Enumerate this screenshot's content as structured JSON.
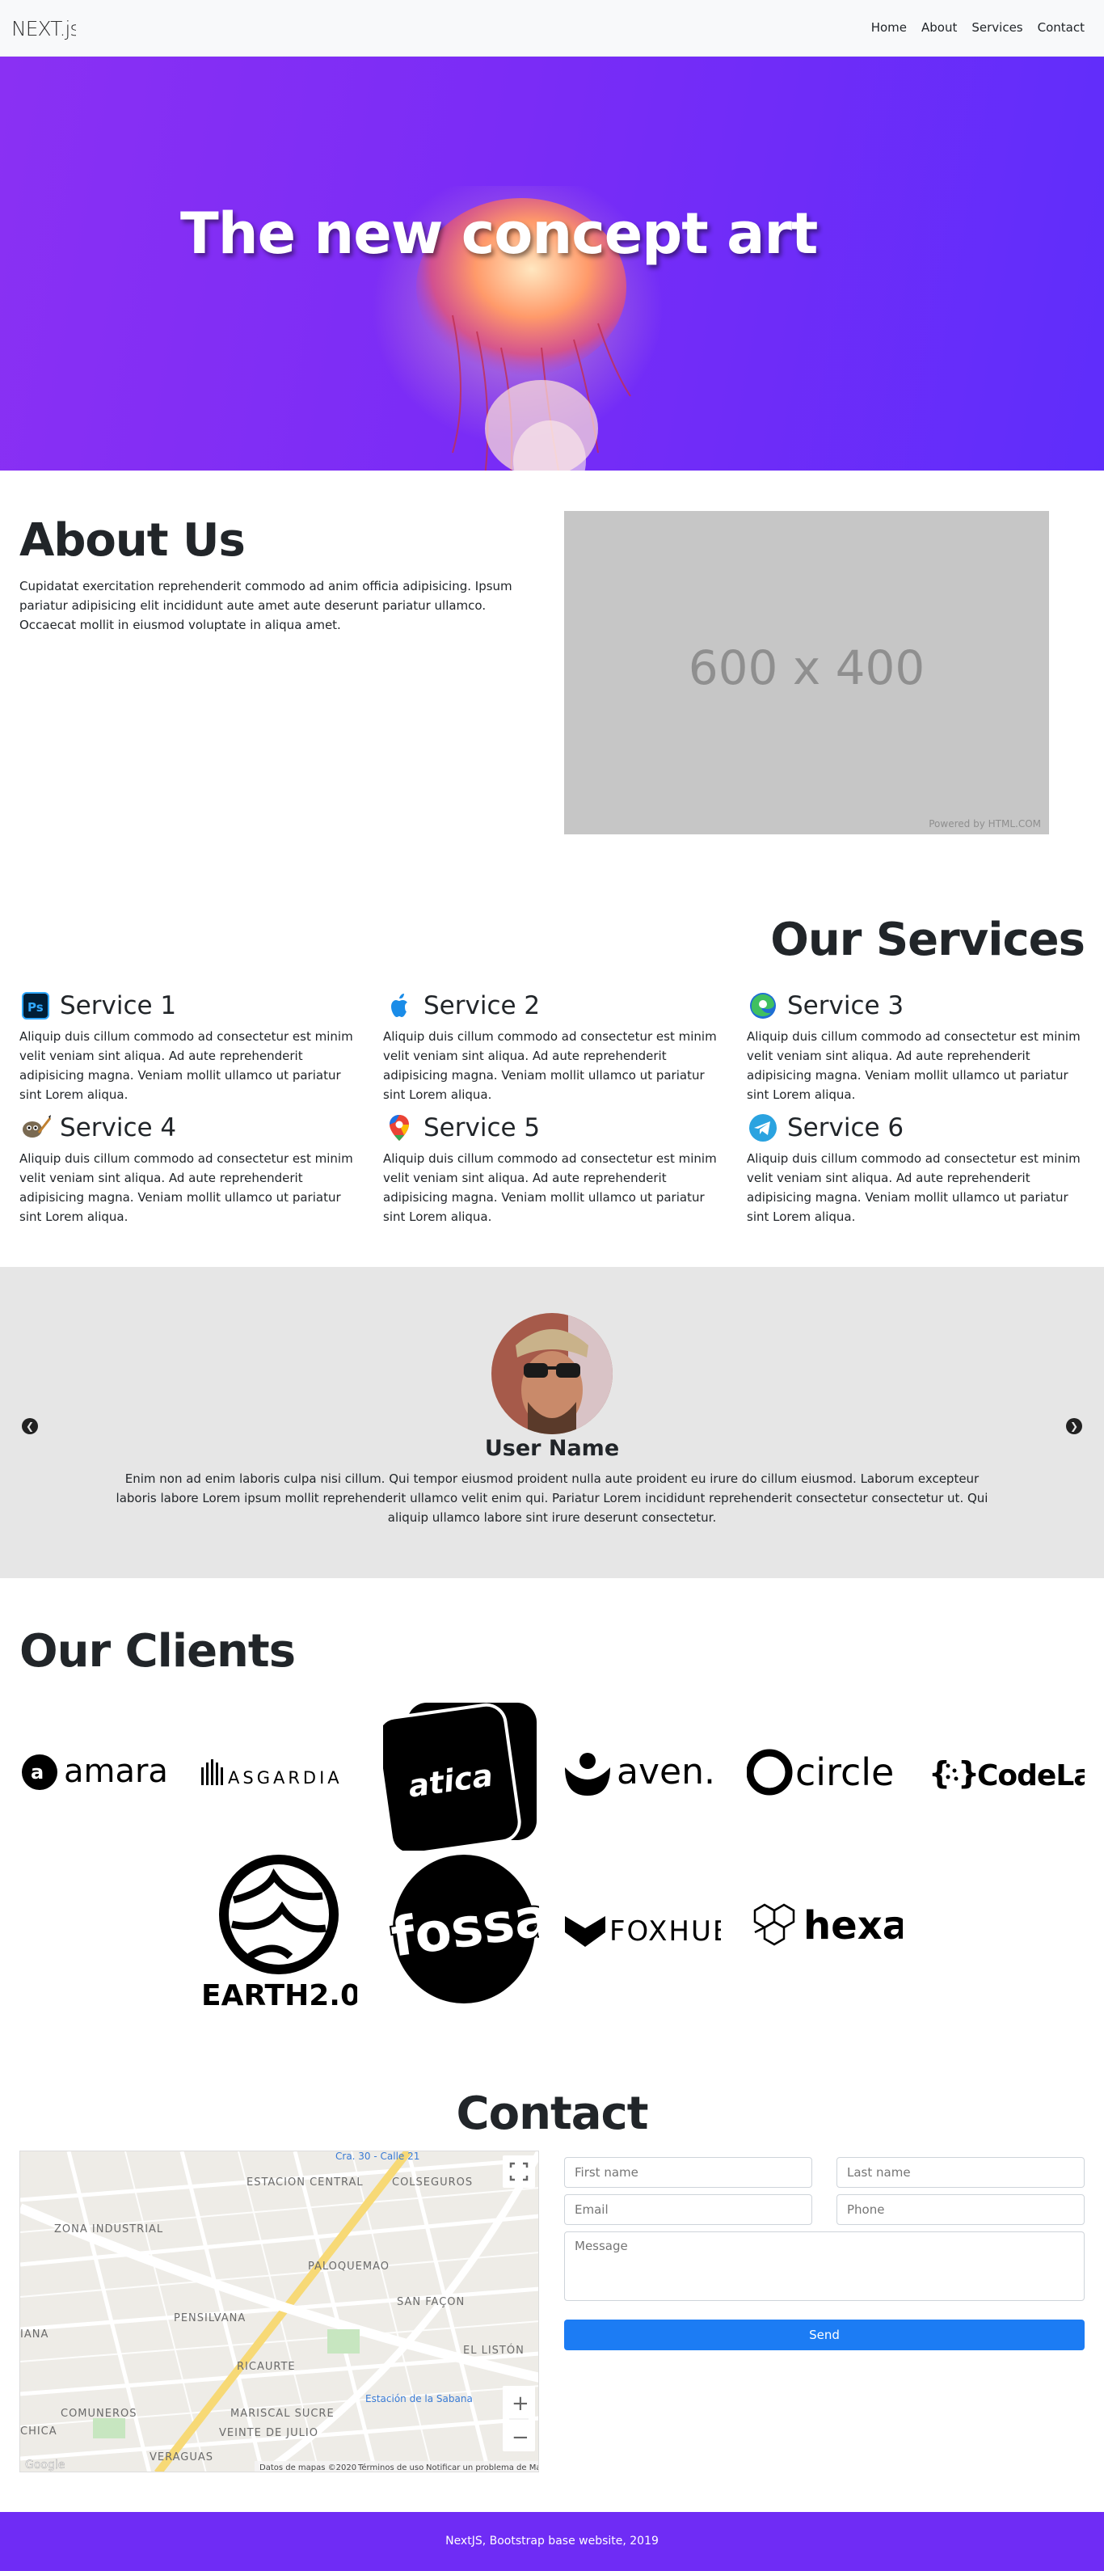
{
  "nav": {
    "logo_text": "NEXT.js",
    "links": [
      "Home",
      "About",
      "Services",
      "Contact"
    ]
  },
  "hero": {
    "title": "The new concept art"
  },
  "about": {
    "title": "About Us",
    "text": "Cupidatat exercitation reprehenderit commodo ad anim officia adipisicing. Ipsum pariatur adipisicing elit incididunt aute amet aute deserunt pariatur ullamco. Occaecat mollit in eiusmod voluptate in aliqua amet.",
    "placeholder_size": "600 x 400",
    "placeholder_credit": "Powered by HTML.COM"
  },
  "services": {
    "title": "Our Services",
    "items": [
      {
        "name": "Service 1",
        "icon": "photoshop-icon",
        "text": "Aliquip duis cillum commodo ad consectetur est minim velit veniam sint aliqua. Ad aute reprehenderit adipisicing magna. Veniam mollit ullamco ut pariatur sint Lorem aliqua."
      },
      {
        "name": "Service 2",
        "icon": "apple-icon",
        "text": "Aliquip duis cillum commodo ad consectetur est minim velit veniam sint aliqua. Ad aute reprehenderit adipisicing magna. Veniam mollit ullamco ut pariatur sint Lorem aliqua."
      },
      {
        "name": "Service 3",
        "icon": "edge-icon",
        "text": "Aliquip duis cillum commodo ad consectetur est minim velit veniam sint aliqua. Ad aute reprehenderit adipisicing magna. Veniam mollit ullamco ut pariatur sint Lorem aliqua."
      },
      {
        "name": "Service 4",
        "icon": "gimp-icon",
        "text": "Aliquip duis cillum commodo ad consectetur est minim velit veniam sint aliqua. Ad aute reprehenderit adipisicing magna. Veniam mollit ullamco ut pariatur sint Lorem aliqua."
      },
      {
        "name": "Service 5",
        "icon": "google-maps-icon",
        "text": "Aliquip duis cillum commodo ad consectetur est minim velit veniam sint aliqua. Ad aute reprehenderit adipisicing magna. Veniam mollit ullamco ut pariatur sint Lorem aliqua."
      },
      {
        "name": "Service 6",
        "icon": "telegram-icon",
        "text": "Aliquip duis cillum commodo ad consectetur est minim velit veniam sint aliqua. Ad aute reprehenderit adipisicing magna. Veniam mollit ullamco ut pariatur sint Lorem aliqua."
      }
    ]
  },
  "testimonial": {
    "name": "User Name",
    "text": "Enim non ad enim laboris culpa nisi cillum. Qui tempor eiusmod proident nulla aute proident eu irure do cillum eiusmod. Laborum excepteur laboris labore Lorem ipsum mollit reprehenderit ullamco velit enim qui. Pariatur Lorem incididunt reprehenderit consectetur consectetur ut. Qui aliquip ullamco labore sint irure deserunt consectetur.",
    "prev_icon": "chevron-left-icon",
    "next_icon": "chevron-right-icon"
  },
  "clients": {
    "title": "Our Clients",
    "logos": [
      "amara",
      "ASGARDIA",
      "atica",
      "aven.",
      "circle",
      "CodeLab",
      "EARTH2.0",
      "fossa",
      "FOXHUB",
      "hexa"
    ]
  },
  "contact": {
    "title": "Contact",
    "first_name_placeholder": "First name",
    "last_name_placeholder": "Last name",
    "email_placeholder": "Email",
    "phone_placeholder": "Phone",
    "message_placeholder": "Message",
    "send_label": "Send",
    "map": {
      "labels": [
        "ESTACION CENTRAL",
        "COLSEGUROS",
        "ZONA INDUSTRIAL",
        "PALOQUEMAO",
        "PENSILVANA",
        "SAN FAÇON",
        "RICAURTE",
        "EL LISTÓN",
        "COMUNEROS",
        "MARISCAL SUCRE",
        "VEINTE DE JULIO",
        "VERAGUAS",
        "Estación de la Sabana",
        "Cra. 30 - Calle 21",
        "IANA",
        "CHICA"
      ],
      "attribution": "Datos de mapas ©2020",
      "terms": "Términos de uso",
      "report": "Notificar un problema de Maps",
      "zoom_in": "+",
      "zoom_out": "−",
      "google": "Google"
    }
  },
  "footer": {
    "text": "NextJS, Bootstrap base website, 2019"
  }
}
